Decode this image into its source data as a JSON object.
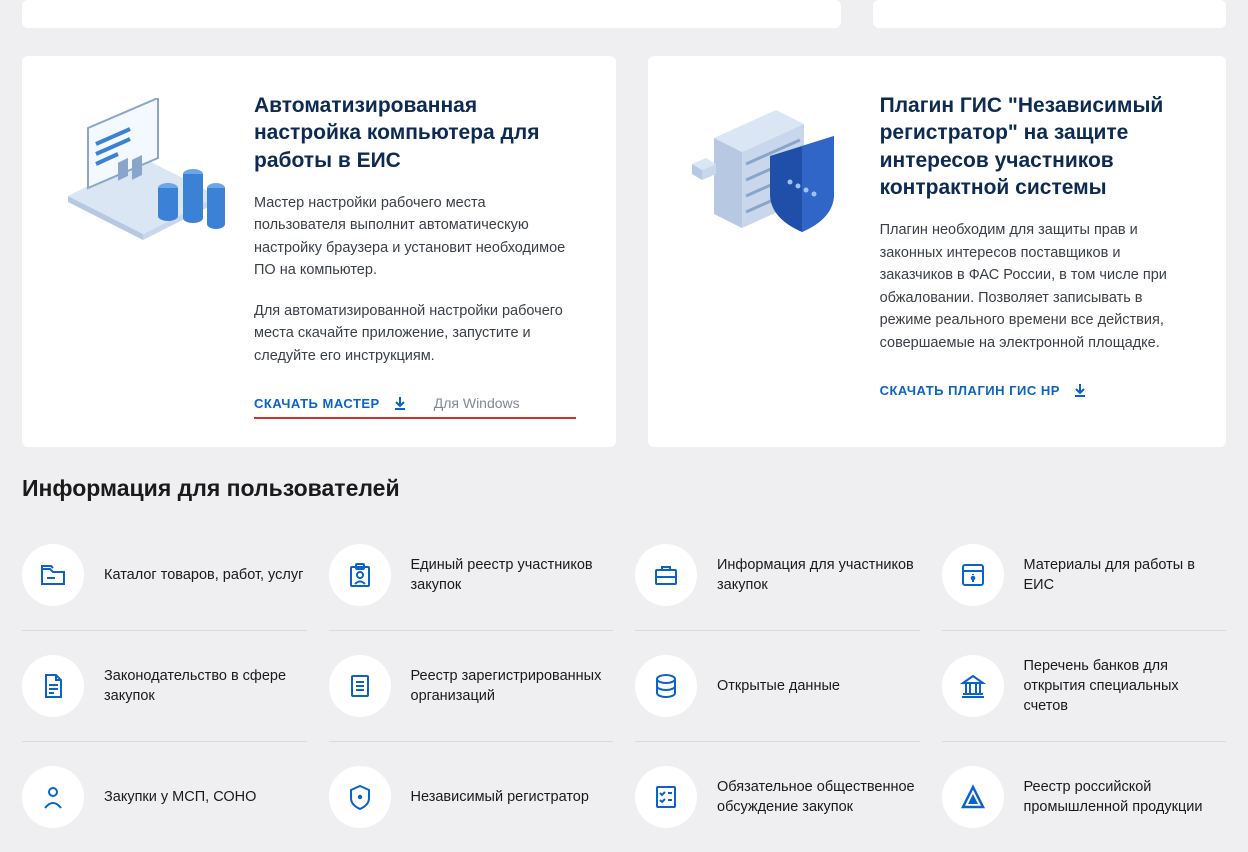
{
  "cards": {
    "left": {
      "title": "Автоматизированная настройка компьютера для работы в ЕИС",
      "p1": "Мастер настройки рабочего места пользователя выполнит автоматическую настройку браузера и установит необходимое ПО на компьютер.",
      "p2": "Для автоматизированной настройки рабочего места скачайте приложение, запустите и следуйте его инструкциям.",
      "download_label": "СКАЧАТЬ МАСТЕР",
      "download_hint": "Для Windows"
    },
    "right": {
      "title": "Плагин ГИС \"Независимый регистратор\" на защите интересов участников контрактной системы",
      "p1": "Плагин необходим для защиты прав и законных интересов поставщиков и заказчиков в ФАС России, в том числе при обжаловании. Позволяет записывать в режиме реального времени все действия, совершаемые на электронной площадке.",
      "download_label": "СКАЧАТЬ ПЛАГИН ГИС НР"
    }
  },
  "section_title": "Информация для пользователей",
  "info": [
    {
      "label": "Каталог товаров, работ, услуг"
    },
    {
      "label": "Единый реестр участников закупок"
    },
    {
      "label": "Информация для участников закупок"
    },
    {
      "label": "Материалы для работы в ЕИС"
    },
    {
      "label": "Законодательство в сфере закупок"
    },
    {
      "label": "Реестр зарегистрированных организаций"
    },
    {
      "label": "Открытые данные"
    },
    {
      "label": "Перечень банков для открытия специальных счетов"
    },
    {
      "label": "Закупки у МСП, СОНО"
    },
    {
      "label": "Независимый регистратор"
    },
    {
      "label": "Обязательное общественное обсуждение закупок"
    },
    {
      "label": "Реестр российской промышленной продукции"
    }
  ]
}
